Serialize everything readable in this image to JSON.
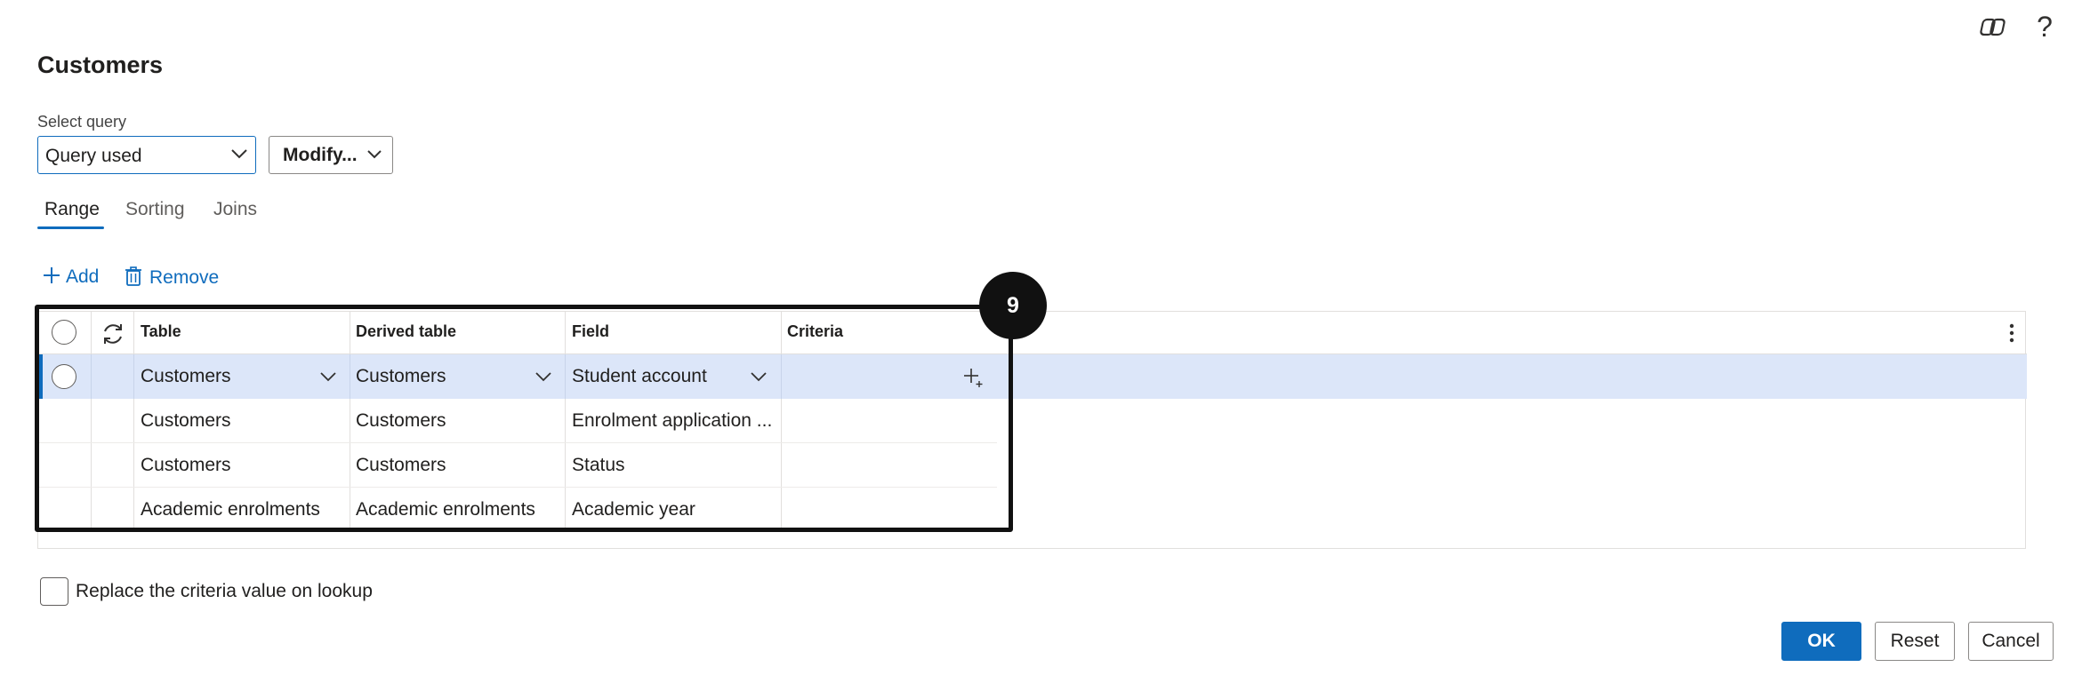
{
  "header": {
    "title": "Customers",
    "help_label": "?"
  },
  "query": {
    "label": "Select query",
    "selected": "Query used",
    "modify_label": "Modify..."
  },
  "tabs": [
    {
      "label": "Range",
      "active": true
    },
    {
      "label": "Sorting",
      "active": false
    },
    {
      "label": "Joins",
      "active": false
    }
  ],
  "toolbar": {
    "add_label": "Add",
    "remove_label": "Remove"
  },
  "grid": {
    "columns": [
      "Table",
      "Derived table",
      "Field",
      "Criteria"
    ],
    "rows": [
      {
        "table": "Customers",
        "derived_table": "Customers",
        "field": "Student account",
        "criteria": "",
        "selected": true
      },
      {
        "table": "Customers",
        "derived_table": "Customers",
        "field": "Enrolment application ...",
        "criteria": "",
        "selected": false
      },
      {
        "table": "Customers",
        "derived_table": "Customers",
        "field": "Status",
        "criteria": "",
        "selected": false
      },
      {
        "table": "Academic enrolments",
        "derived_table": "Academic enrolments",
        "field": "Academic year",
        "criteria": "",
        "selected": false
      }
    ]
  },
  "annotation": {
    "badge": "9"
  },
  "options": {
    "replace_label": "Replace the criteria value on lookup",
    "replace_checked": false
  },
  "footer": {
    "ok_label": "OK",
    "reset_label": "Reset",
    "cancel_label": "Cancel"
  },
  "colors": {
    "accent": "#0f6cbd",
    "selected_row": "#dce6f9",
    "annotation": "#111111"
  }
}
